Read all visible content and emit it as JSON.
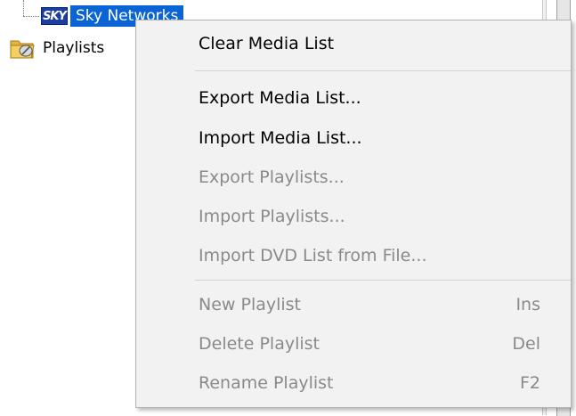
{
  "tree": {
    "items": [
      {
        "label": "Sky Networks",
        "icon": "sky-logo-icon",
        "selected": true
      },
      {
        "label": "Playlists",
        "icon": "folder-icon",
        "selected": false
      }
    ],
    "sky_icon_text": "SKY"
  },
  "context_menu": {
    "items": [
      {
        "label": "Clear Media List",
        "enabled": true,
        "shortcut": ""
      },
      {
        "label": "Export Media List...",
        "enabled": true,
        "shortcut": ""
      },
      {
        "label": "Import Media List...",
        "enabled": true,
        "shortcut": ""
      },
      {
        "label": "Export Playlists...",
        "enabled": false,
        "shortcut": ""
      },
      {
        "label": "Import Playlists...",
        "enabled": false,
        "shortcut": ""
      },
      {
        "label": "Import DVD List from File...",
        "enabled": false,
        "shortcut": ""
      },
      {
        "label": "New Playlist",
        "enabled": false,
        "shortcut": "Ins"
      },
      {
        "label": "Delete Playlist",
        "enabled": false,
        "shortcut": "Del"
      },
      {
        "label": "Rename Playlist",
        "enabled": false,
        "shortcut": "F2"
      }
    ]
  },
  "colors": {
    "selection": "#0a64d6",
    "menu_background": "#f2f2f2",
    "disabled_text": "#8a8a8a",
    "enabled_text": "#000000"
  }
}
